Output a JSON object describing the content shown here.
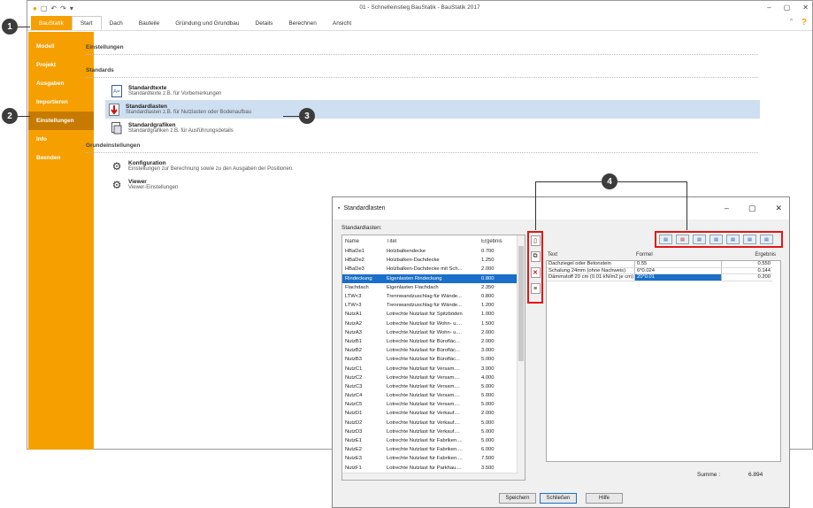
{
  "window": {
    "title": "01 - Schnelleinstieg BauStatik - BauStatik 2017"
  },
  "tabs": [
    "BauStatik",
    "Start",
    "Dach",
    "Bauteile",
    "Gründung und Grundbau",
    "Details",
    "Berechnen",
    "Ansicht"
  ],
  "sidebar": [
    "Modell",
    "Projekt",
    "Ausgaben",
    "Importieren",
    "Einstellungen",
    "Info",
    "Beenden"
  ],
  "content": {
    "heading": "Einstellungen",
    "standards_heading": "Standards",
    "items": [
      {
        "title": "Standardtexte",
        "desc": "Standardtexte z.B. für Vorbemerkungen"
      },
      {
        "title": "Standardlasten",
        "desc": "Standardlasten z.B. für Nutzlasten oder Bodenaufbau"
      },
      {
        "title": "Standardgrafiken",
        "desc": "Standardgrafiken z.B. für Ausführungsdetails"
      }
    ],
    "grund_heading": "Grundeinstellungen",
    "grund_items": [
      {
        "title": "Konfiguration",
        "desc": "Einstellungen zur Berechnung sowie zu den Ausgaben der Positionen."
      },
      {
        "title": "Viewer",
        "desc": "Viewer-Einstellungen"
      }
    ]
  },
  "callouts": [
    "1",
    "2",
    "3",
    "4"
  ],
  "dialog": {
    "title": "Standardlasten",
    "list_label": "Standardlasten:",
    "columns": [
      "Name",
      "Titel",
      "Ergebnis"
    ],
    "rows": [
      [
        "HBaDe1",
        "Holzbalkendecke",
        "0.700"
      ],
      [
        "HBaDe2",
        "Holzbalken-Dachdecke",
        "1.250"
      ],
      [
        "HBaDe3",
        "Holzbalken-Dachdecke mit Sch...",
        "2.000"
      ],
      [
        "Rindeckung",
        "Eigenlasten Rindeckung",
        "0.800"
      ],
      [
        "Flachdach",
        "Eigenlasten Flachdach",
        "2.350"
      ],
      [
        "LTW<3",
        "Trennwandzuschlag für Wände...",
        "0.800"
      ],
      [
        "LTW>3",
        "Trennwandzuschlag für Wände...",
        "1.200"
      ],
      [
        "NutzA1",
        "Lotrechte Nutzlast für Spitzböden",
        "1.000"
      ],
      [
        "NutzA2",
        "Lotrechte Nutzlast für Wohn- u....",
        "1.500"
      ],
      [
        "NutzA3",
        "Lotrechte Nutzlast für Wohn- u....",
        "2.000"
      ],
      [
        "NutzB1",
        "Lotrechte Nutzlast für Büroflác...",
        "2.000"
      ],
      [
        "NutzB2",
        "Lotrechte Nutzlast für Büroflác...",
        "3.000"
      ],
      [
        "NutzB3",
        "Lotrechte Nutzlast für Büroflác...",
        "5.000"
      ],
      [
        "NutzC1",
        "Lotrechte Nutzlast für Versam....",
        "3.000"
      ],
      [
        "NutzC2",
        "Lotrechte Nutzlast für Versam....",
        "4.000"
      ],
      [
        "NutzC3",
        "Lotrechte Nutzlast für Versam....",
        "5.000"
      ],
      [
        "NutzC4",
        "Lotrechte Nutzlast für Versam....",
        "5.000"
      ],
      [
        "NutzC5",
        "Lotrechte Nutzlast für Versam....",
        "5.000"
      ],
      [
        "NutzD1",
        "Lotrechte Nutzlast für Verkauf....",
        "2.000"
      ],
      [
        "NutzD2",
        "Lotrechte Nutzlast für Verkauf....",
        "5.000"
      ],
      [
        "NutzD3",
        "Lotrechte Nutzlast für Verkauf....",
        "5.000"
      ],
      [
        "NutzE1",
        "Lotrechte Nutzlast für Fabriken....",
        "5.000"
      ],
      [
        "NutzE2",
        "Lotrechte Nutzlast für Fabriken....",
        "6.000"
      ],
      [
        "NutzE3",
        "Lotrechte Nutzlast für Fabriken....",
        "7.500"
      ],
      [
        "NutzF1",
        "Lotrechte Nutzlast für Parkhau....",
        "3.500"
      ]
    ],
    "selected_index": 3,
    "grid_columns": [
      "Text",
      "Formel",
      "Ergebnis"
    ],
    "grid_rows": [
      [
        "Dachziegel oder Betonstein",
        "0.55",
        "0.550"
      ],
      [
        "Schalung 24mm (ohne Nachweis)",
        "6*0.024",
        "0.144"
      ],
      [
        "Dämmstoff 20 cm (0.01 kN/m2 je cm)",
        "20*0.01",
        "0.200"
      ]
    ],
    "summe_label": "Summe :",
    "summe_value": "6.894",
    "buttons": [
      "Speichern",
      "Schließen",
      "Hilfe"
    ]
  }
}
